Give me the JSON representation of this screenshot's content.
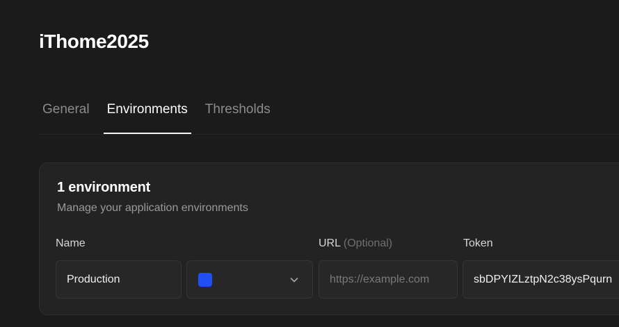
{
  "project": {
    "title": "iThome2025"
  },
  "tabs": [
    {
      "label": "General",
      "active": false
    },
    {
      "label": "Environments",
      "active": true
    },
    {
      "label": "Thresholds",
      "active": false
    }
  ],
  "card": {
    "title": "1 environment",
    "subtitle": "Manage your application environments",
    "columns": {
      "name": "Name",
      "url": "URL",
      "url_optional": "(Optional)",
      "token": "Token"
    },
    "rows": [
      {
        "name": "Production",
        "color": "#1f4ff5",
        "url_placeholder": "https://example.com",
        "token": "sbDPYIZLztpN2c38ysPqurn"
      }
    ]
  }
}
